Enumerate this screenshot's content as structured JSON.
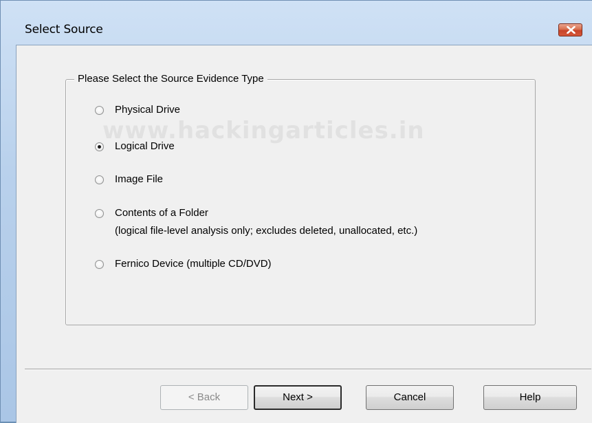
{
  "window": {
    "title": "Select Source",
    "close_icon": "close-icon"
  },
  "groupbox": {
    "label": "Please Select the Source Evidence Type",
    "options": [
      {
        "label": "Physical Drive",
        "selected": false
      },
      {
        "label": "Logical Drive",
        "selected": true
      },
      {
        "label": "Image File",
        "selected": false
      },
      {
        "label": "Contents of a Folder",
        "note": "(logical file-level analysis only; excludes deleted, unallocated, etc.)",
        "selected": false
      },
      {
        "label": "Fernico Device (multiple CD/DVD)",
        "selected": false
      }
    ]
  },
  "watermark": "www.hackingarticles.in",
  "buttons": {
    "back": "< Back",
    "next": "Next >",
    "cancel": "Cancel",
    "help": "Help"
  },
  "colors": {
    "close_button": "#c7442a",
    "dialog_background": "#f0f0f0"
  }
}
